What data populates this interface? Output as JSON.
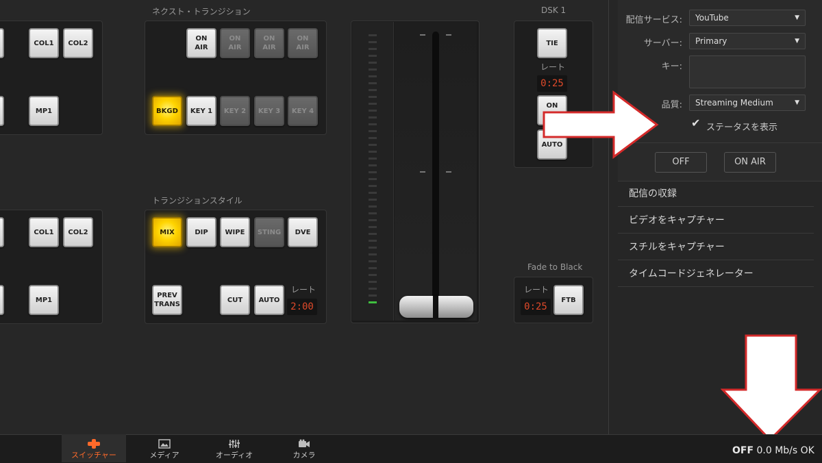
{
  "switcher": {
    "upper_row": {
      "top": [
        "COL1",
        "COL2"
      ],
      "bottom": [
        "MP1"
      ]
    },
    "lower_row": {
      "top": [
        "COL1",
        "COL2"
      ],
      "bottom": [
        "MP1"
      ]
    }
  },
  "next_transition": {
    "title": "ネクスト・トランジション",
    "on_air": [
      "ON\nAIR",
      "ON\nAIR",
      "ON\nAIR",
      "ON\nAIR"
    ],
    "layers": [
      "BKGD",
      "KEY 1",
      "KEY 2",
      "KEY 3",
      "KEY 4"
    ]
  },
  "transition_style": {
    "title": "トランジションスタイル",
    "styles": [
      "MIX",
      "DIP",
      "WIPE",
      "STING",
      "DVE"
    ],
    "prev_trans": "PREV\nTRANS",
    "cut": "CUT",
    "auto": "AUTO",
    "rate_label": "レート",
    "rate_value": "2:00"
  },
  "dsk": {
    "title": "DSK 1",
    "tie": "TIE",
    "rate_label": "レート",
    "rate_value": "0:25",
    "on_air": "ON\nAIR",
    "auto": "AUTO"
  },
  "fade_to_black": {
    "title": "Fade to Black",
    "rate_label": "レート",
    "rate_value": "0:25",
    "ftb": "FTB"
  },
  "stream_settings": {
    "service_label": "配信サービス:",
    "service_value": "YouTube",
    "server_label": "サーバー:",
    "server_value": "Primary",
    "key_label": "キー:",
    "key_value": "",
    "quality_label": "品質:",
    "quality_value": "Streaming Medium",
    "show_status_label": "ステータスを表示",
    "show_status_checked": true,
    "off_button": "OFF",
    "on_air_button": "ON AIR"
  },
  "menu": [
    "配信の収録",
    "ビデオをキャプチャー",
    "スチルをキャプチャー",
    "タイムコードジェネレーター"
  ],
  "tabs": [
    "スイッチャー",
    "メディア",
    "オーディオ",
    "カメラ"
  ],
  "status": {
    "state": "OFF",
    "rate": "0.0 Mb/s OK"
  },
  "colors": {
    "background": "#272727",
    "lit_button": "#ffd400",
    "tally": "#e04a2a",
    "annotation_arrow": "#d42a2a",
    "active_tab": "#ff6a2a"
  }
}
